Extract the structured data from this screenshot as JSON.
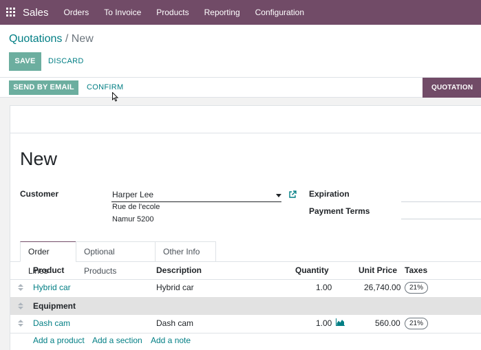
{
  "navbar": {
    "brand": "Sales",
    "menu": [
      "Orders",
      "To Invoice",
      "Products",
      "Reporting",
      "Configuration"
    ]
  },
  "breadcrumb": {
    "parent": "Quotations",
    "separator": "/",
    "current": "New"
  },
  "buttons": {
    "save": "SAVE",
    "discard": "DISCARD",
    "send_email": "SEND BY EMAIL",
    "confirm": "CONFIRM"
  },
  "status": {
    "active": "QUOTATION"
  },
  "form": {
    "title": "New",
    "customer_label": "Customer",
    "customer_value": "Harper Lee",
    "address_line1": "Rue de l'ecole",
    "address_line2": "Namur 5200",
    "expiration_label": "Expiration",
    "payment_terms_label": "Payment Terms"
  },
  "tabs": [
    "Order Lines",
    "Optional Products",
    "Other Info"
  ],
  "table": {
    "headers": {
      "product": "Product",
      "description": "Description",
      "quantity": "Quantity",
      "unit_price": "Unit Price",
      "taxes": "Taxes"
    },
    "rows": [
      {
        "product": "Hybrid car",
        "description": "Hybrid car",
        "quantity": "1.00",
        "unit_price": "26,740.00",
        "tax": "21%"
      },
      {
        "section": "Equipment"
      },
      {
        "product": "Dash cam",
        "description": "Dash cam",
        "quantity": "1.00",
        "unit_price": "560.00",
        "tax": "21%"
      }
    ],
    "add_links": [
      "Add a product",
      "Add a section",
      "Add a note"
    ]
  },
  "colors": {
    "brand": "#714b67",
    "primary": "#6cae9f",
    "link": "#017e84"
  }
}
